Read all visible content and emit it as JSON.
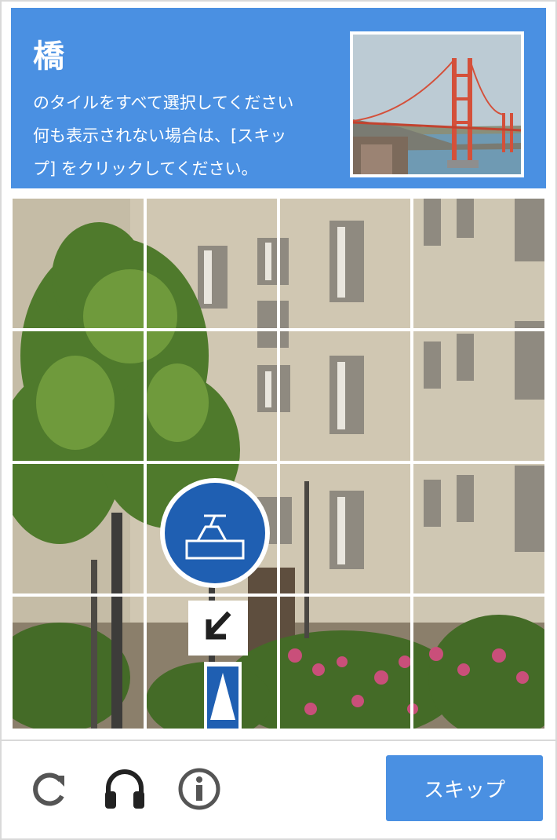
{
  "challenge": {
    "keyword": "橋",
    "instruction_lines": [
      "のタイルをすべて選択してください",
      "何も表示されない場合は、[スキッ",
      "プ] をクリックしてください。"
    ],
    "sample_image": "golden-gate-bridge",
    "accent_color": "#4a90e2"
  },
  "grid": {
    "rows": 4,
    "cols": 4,
    "image": "street-view-building-tree-tram-sign"
  },
  "footer": {
    "icons": [
      "reload-icon",
      "headphones-icon",
      "info-icon"
    ],
    "skip_label": "スキップ"
  }
}
